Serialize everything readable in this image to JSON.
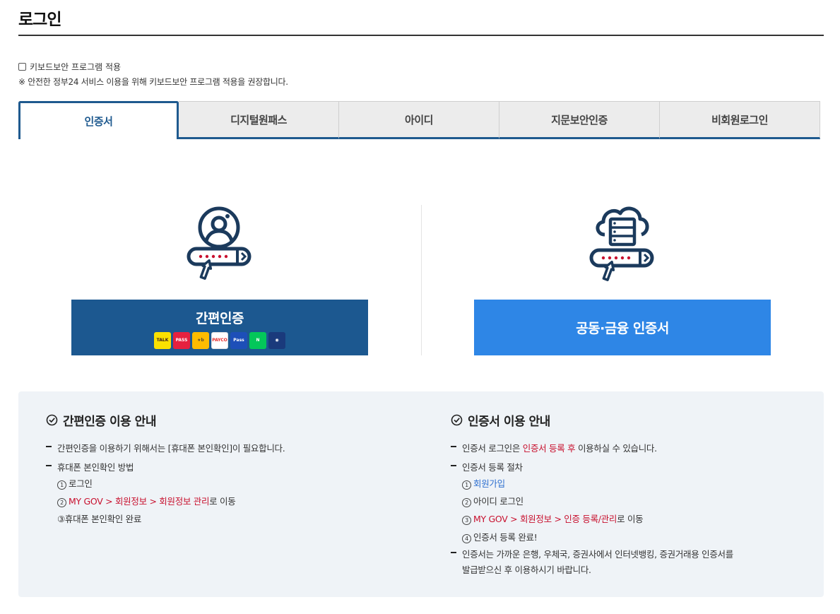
{
  "page": {
    "title": "로그인"
  },
  "keyboard_security": {
    "checkbox_label": "키보드보안 프로그램 적용",
    "checked": false,
    "notice": "※ 안전한 정부24 서비스 이용을 위해 키보드보안 프로그램 적용을 권장합니다."
  },
  "tabs": [
    {
      "label": "인증서",
      "active": true
    },
    {
      "label": "디지털원패스",
      "active": false
    },
    {
      "label": "아이디",
      "active": false
    },
    {
      "label": "지문보안인증",
      "active": false
    },
    {
      "label": "비회원로그인",
      "active": false
    }
  ],
  "login_options": {
    "simple_auth": {
      "label": "간편인증",
      "providers": [
        {
          "name": "kakao",
          "text": "TALK",
          "bg": "#fae100",
          "fg": "#3a1d1d"
        },
        {
          "name": "pass",
          "text": "PASS",
          "bg": "#e5213f",
          "fg": "#ffffff"
        },
        {
          "name": "kb",
          "text": "★b",
          "bg": "#ffbc00",
          "fg": "#5a4a32"
        },
        {
          "name": "payco",
          "text": "PAYCO",
          "bg": "#ffffff",
          "fg": "#e62a2a"
        },
        {
          "name": "samsung-pass",
          "text": "Pass",
          "bg": "#1d4fb8",
          "fg": "#ffffff"
        },
        {
          "name": "naver",
          "text": "N",
          "bg": "#03c75a",
          "fg": "#ffffff"
        },
        {
          "name": "shinhan",
          "text": "◉",
          "bg": "#1a3a7c",
          "fg": "#ffffff"
        }
      ]
    },
    "joint_cert": {
      "label": "공동·금융 인증서"
    }
  },
  "guide": {
    "simple": {
      "title": "간편인증 이용 안내",
      "line1": "간편인증을 이용하기 위해서는 [휴대폰 본인확인]이 필요합니다.",
      "line2": "휴대폰 본인확인 방법",
      "step1_num": "1",
      "step1": "로그인",
      "step2_num": "2",
      "step2_red": "MY GOV > 회원정보 > 회원정보 관리",
      "step2_rest": "로 이동",
      "step3": "③휴대폰 본인확인 완료"
    },
    "cert": {
      "title": "인증서 이용 안내",
      "line1_a": "인증서 로그인은 ",
      "line1_red": "인증서 등록 후",
      "line1_b": " 이용하실 수 있습니다.",
      "line2": "인증서 등록 절차",
      "step1_num": "1",
      "step1_blue": "회원가입",
      "step2_num": "2",
      "step2": "아이디 로그인",
      "step3_num": "3",
      "step3_red": "MY GOV > 회원정보 > 인증 등록/관리",
      "step3_rest": "로 이동",
      "step4_num": "4",
      "step4": "인증서 등록 완료!",
      "line3a": "인증서는 가까운 은행, 우체국, 증권사에서 인터넷뱅킹, 증권거래용 인증서를",
      "line3b": "발급받으신 후 이용하시기 바랍니다."
    }
  },
  "colors": {
    "primary": "#1c5890",
    "secondary_button": "#2e86e6",
    "accent_red": "#c8102e",
    "link_blue": "#2d6fcf",
    "guide_bg": "#eff3f7"
  }
}
